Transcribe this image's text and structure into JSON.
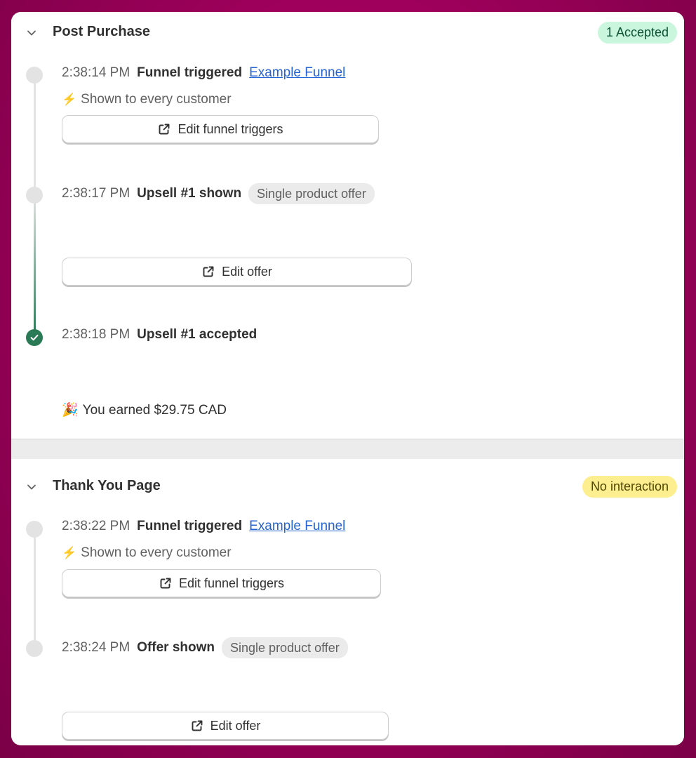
{
  "colors": {
    "accent_green": "#2a7a55",
    "link_blue": "#2463d1",
    "badge_green_bg": "#c9f6dd",
    "badge_yellow_bg": "#fdee8f",
    "frame_magenta": "#a0005c"
  },
  "sections": [
    {
      "title": "Post Purchase",
      "badge": "1 Accepted",
      "badge_status": "green",
      "events": [
        {
          "time": "2:38:14 PM",
          "label": "Funnel triggered",
          "link": "Example Funnel",
          "note": "Shown to every customer",
          "note_icon": "lightning-icon",
          "button": "Edit funnel triggers",
          "button_icon": "external-link-icon"
        },
        {
          "time": "2:38:17 PM",
          "label": "Upsell #1 shown",
          "pill": "Single product offer",
          "button": "Edit offer",
          "button_icon": "external-link-icon"
        },
        {
          "time": "2:38:18 PM",
          "label": "Upsell #1 accepted",
          "status_icon": "check-circle-icon",
          "earned": "You earned $29.75 CAD",
          "earned_icon": "party-popper-icon"
        }
      ]
    },
    {
      "title": "Thank You Page",
      "badge": "No interaction",
      "badge_status": "yellow",
      "events": [
        {
          "time": "2:38:22 PM",
          "label": "Funnel triggered",
          "link": "Example Funnel",
          "note": "Shown to every customer",
          "note_icon": "lightning-icon",
          "button": "Edit funnel triggers",
          "button_icon": "external-link-icon"
        },
        {
          "time": "2:38:24 PM",
          "label": "Offer shown",
          "pill": "Single product offer",
          "button": "Edit offer",
          "button_icon": "external-link-icon"
        }
      ]
    }
  ]
}
